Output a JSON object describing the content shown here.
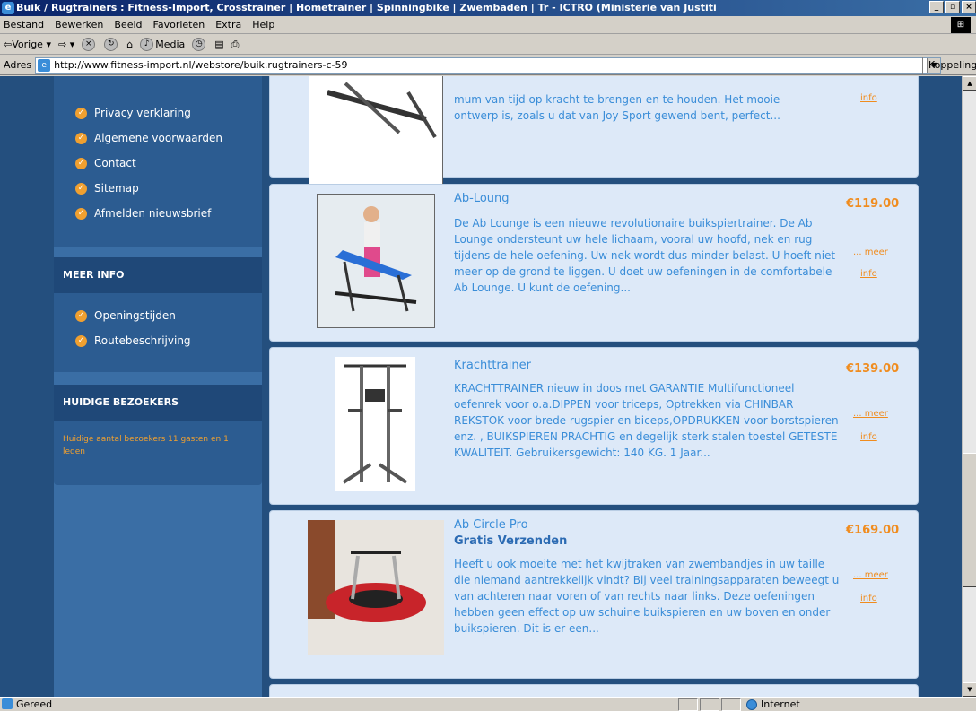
{
  "window": {
    "title": "Buik / Rugtrainers : Fitness-Import, Crosstrainer | Hometrainer | Spinningbike | Zwembaden | Tr - ICTRO (Ministerie van Justiti"
  },
  "menubar": [
    "Bestand",
    "Bewerken",
    "Beeld",
    "Favorieten",
    "Extra",
    "Help"
  ],
  "toolbar": {
    "back": "Vorige",
    "media": "Media"
  },
  "address": {
    "label": "Adres",
    "url": "http://www.fitness-import.nl/webstore/buik.rugtrainers-c-59",
    "links": "Koppelingen"
  },
  "sidebar": {
    "menu_items": [
      "Privacy verklaring",
      "Algemene voorwaarden",
      "Contact",
      "Sitemap",
      "Afmelden nieuwsbrief"
    ],
    "meer_info_title": "MEER INFO",
    "meer_info_items": [
      "Openingstijden",
      "Routebeschrijving"
    ],
    "visitors_title": "HUIDIGE BEZOEKERS",
    "visitors_text": "Huidige aantal bezoekers 11 gasten en 1 leden"
  },
  "products": [
    {
      "title": "",
      "desc_line1": "mum van tijd op kracht te brengen en te houden. Het mooie",
      "desc_line2": "ontwerp is, zoals u dat van Joy Sport gewend bent, perfect...",
      "info": "info"
    },
    {
      "title": "Ab-Loung",
      "price": "€119.00",
      "desc": "De Ab Lounge is een nieuwe revolutionaire buikspiertrainer. De Ab Lounge ondersteunt uw hele lichaam, vooral uw hoofd, nek en rug tijdens de hele oefening. Uw nek wordt dus minder belast. U hoeft niet meer op de grond te liggen. U doet uw oefeningen in de comfortabele Ab Lounge. U kunt de oefening...",
      "more": "... meer",
      "info": "info"
    },
    {
      "title": "Krachttrainer",
      "price": "€139.00",
      "desc": "KRACHTTRAINER nieuw in doos met GARANTIE Multifunctioneel oefenrek voor o.a.DIPPEN voor triceps, Optrekken via CHINBAR REKSTOK voor brede rugspier en biceps,OPDRUKKEN voor borstspieren enz. , BUIKSPIEREN PRACHTIG en degelijk sterk stalen toestel GETESTE KWALITEIT. Gebruikersgewicht: 140 KG. 1 Jaar...",
      "more": "... meer",
      "info": "info"
    },
    {
      "title": "Ab Circle Pro",
      "subtitle": "Gratis Verzenden",
      "price": "€169.00",
      "desc": "Heeft u ook moeite met het kwijtraken van zwembandjes in uw taille die niemand aantrekkelijk vindt? Bij veel trainingsapparaten beweegt u van achteren naar voren of van rechts naar links. Deze oefeningen hebben geen effect op uw schuine buikspieren en uw boven en onder buikspieren. Dit is er een...",
      "more": "... meer",
      "info": "info"
    }
  ],
  "status": {
    "text": "Gereed",
    "zone": "Internet"
  }
}
